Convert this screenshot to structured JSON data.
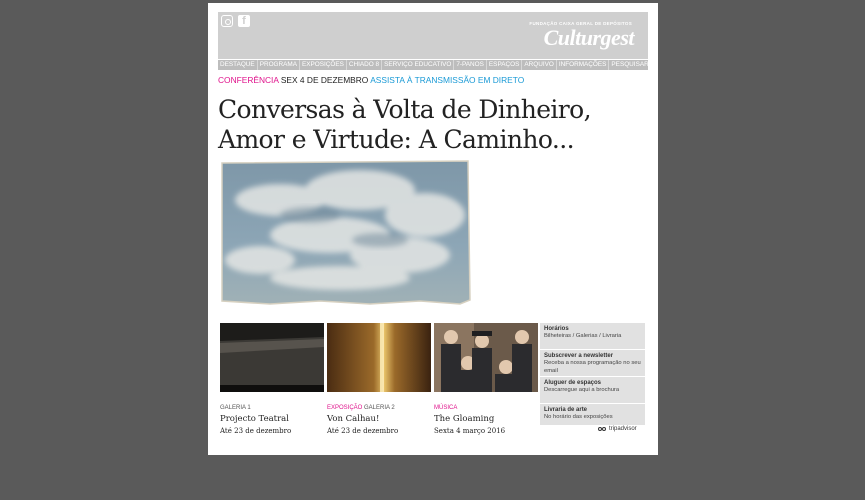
{
  "header": {
    "brand_sub": "FUNDAÇÃO CAIXA GERAL DE DEPÓSITOS",
    "brand": "Culturgest",
    "social": [
      "instagram-icon",
      "facebook-icon"
    ]
  },
  "nav": {
    "items": [
      "DESTAQUE",
      "PROGRAMA",
      "EXPOSIÇÕES",
      "CHIADO 8",
      "SERVIÇO EDUCATIVO",
      "7-PANOS",
      "ESPAÇOS",
      "ARQUIVO",
      "INFORMAÇÕES",
      "PESQUISAR"
    ]
  },
  "featured": {
    "category": "CONFERÊNCIA",
    "date": "SEX 4 DE DEZEMBRO",
    "link": "ASSISTA À TRANSMISSÃO EM DIRETO",
    "title_line1": "Conversas à Volta de Dinheiro,",
    "title_line2": "Amor e Virtude: A Caminho..."
  },
  "tiles": [
    {
      "category": "",
      "venue": "GALERIA 1",
      "title": "Projecto Teatral",
      "when": "Até 23 de dezembro"
    },
    {
      "category": "EXPOSIÇÃO",
      "venue": "GALERIA 2",
      "title": "Von Calhau!",
      "when": "Até 23 de dezembro"
    },
    {
      "category": "MÚSICA",
      "venue": "",
      "title": "The Gloaming",
      "when": "Sexta 4 março 2016"
    }
  ],
  "info": [
    {
      "title": "Horários",
      "desc": "Bilheteiras / Galerias / Livraria"
    },
    {
      "title": "Subscrever a newsletter",
      "desc": "Receba a nossa programação no seu email"
    },
    {
      "title": "Aluguer de espaços",
      "desc": "Descarregue aqui a brochura"
    },
    {
      "title": "Livraria de arte",
      "desc": "No horário das exposições"
    }
  ],
  "tripadvisor": "tripadvisor"
}
